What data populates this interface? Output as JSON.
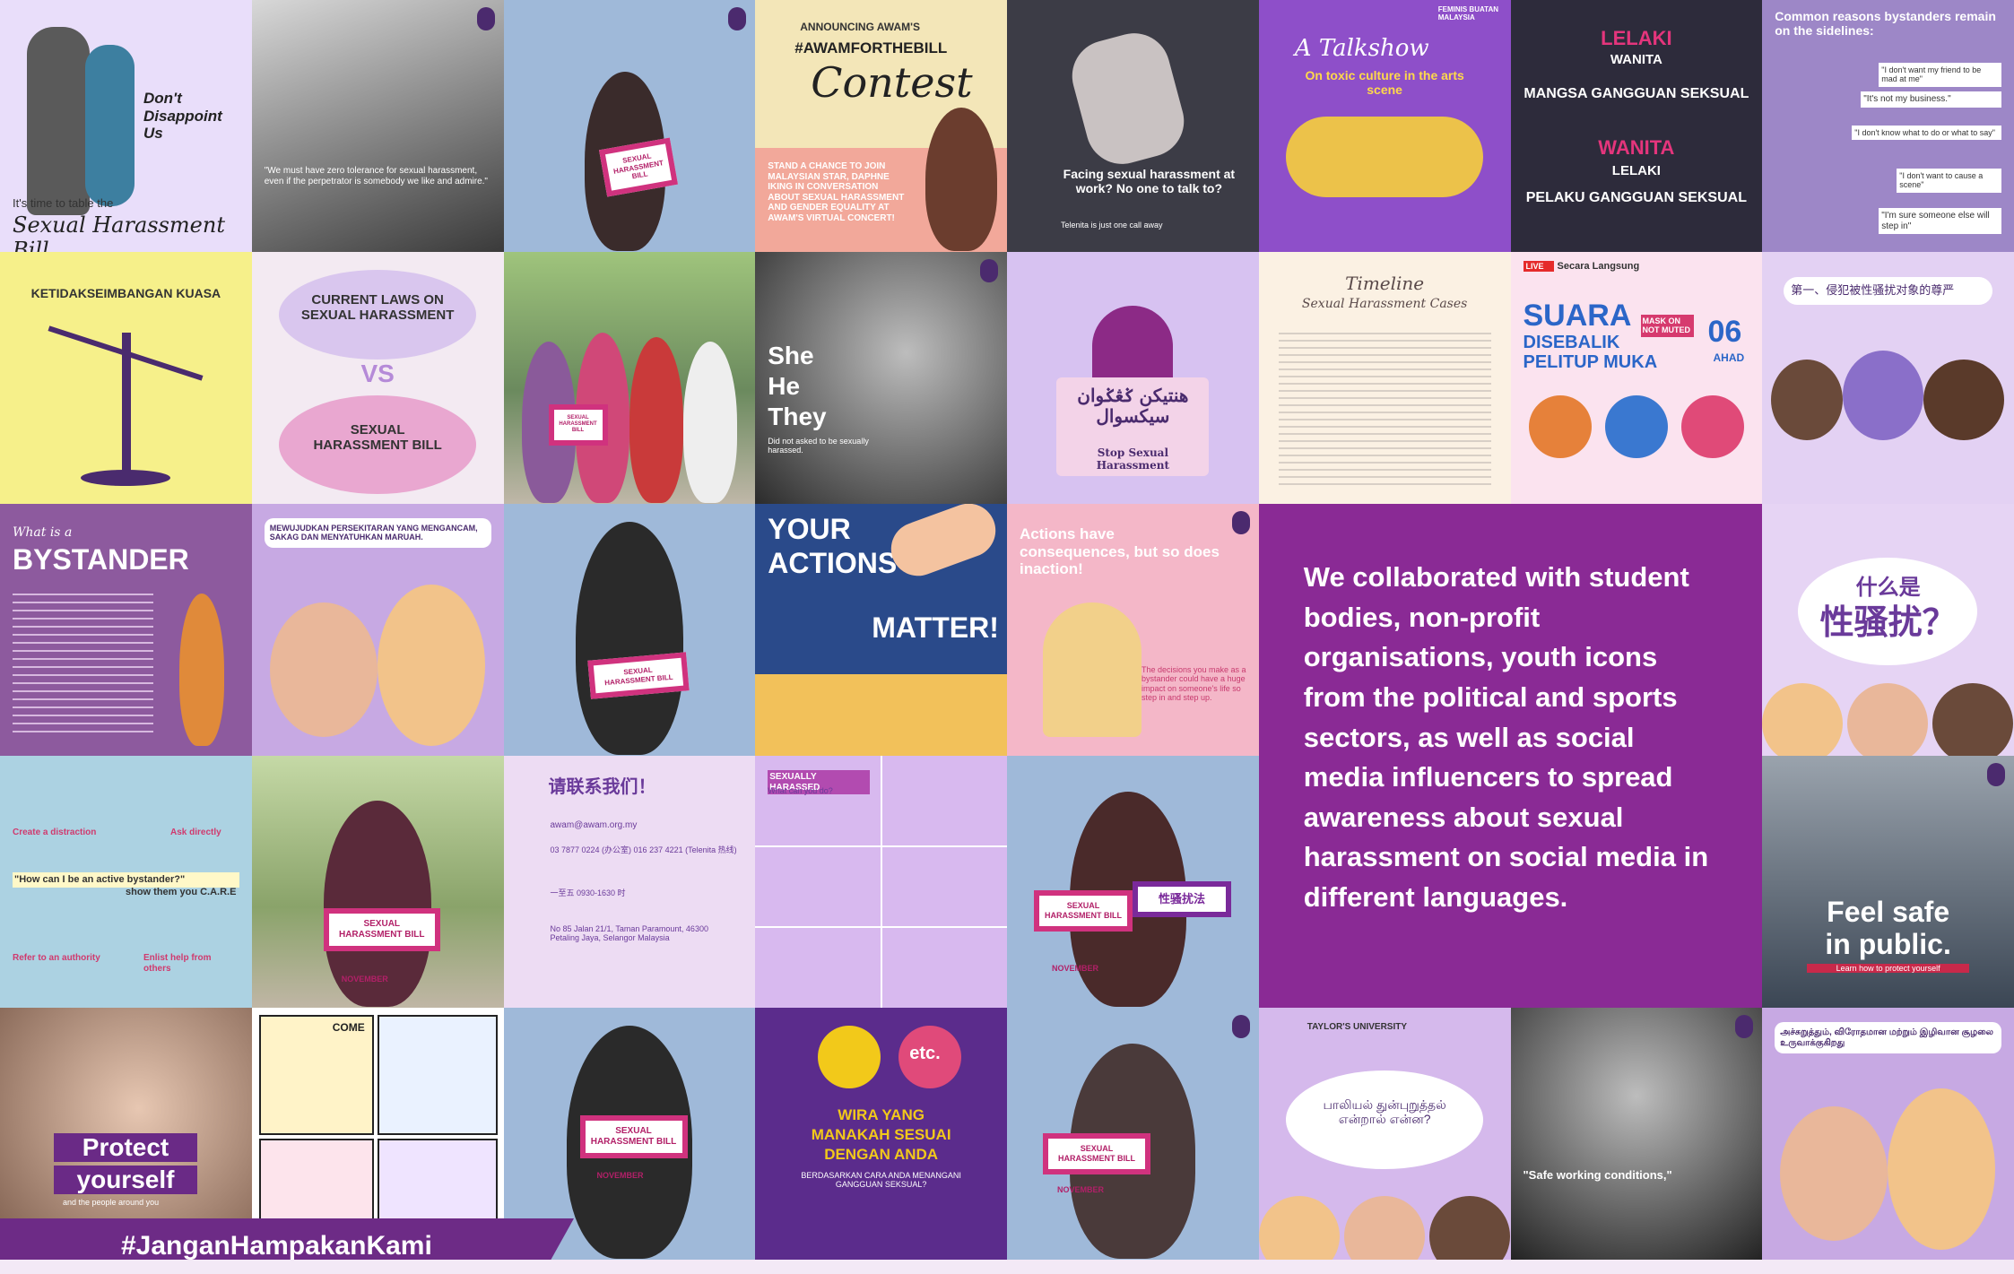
{
  "tiles": {
    "t1": {
      "title": "Don't Disappoint Us",
      "footer": "It's time to table the",
      "script": "Sexual Harassment Bill"
    },
    "t2": {
      "quote": "\"We must have zero tolerance for sexual harassment, even if the perpetrator is somebody we like and admire.\""
    },
    "t3": {
      "sign": "SEXUAL HARASSMENT BILL"
    },
    "t4": {
      "top": "ANNOUNCING AWAM'S",
      "tag": "#AWAMFORTHEBILL",
      "script": "Contest",
      "body": "STAND A CHANCE TO JOIN MALAYSIAN STAR, DAPHNE IKING IN CONVERSATION ABOUT SEXUAL HARASSMENT AND GENDER EQUALITY AT AWAM'S VIRTUAL CONCERT!"
    },
    "t5": {
      "text": "Facing sexual harassment at work? No one to talk to?",
      "small": "Telenita is just one call away"
    },
    "t6": {
      "script": "A Talkshow",
      "sub": "On toxic culture in the arts scene",
      "corner": "FEMINIS BUATAN MALAYSIA"
    },
    "t7": {
      "l1": "LELAKI",
      "l2": "WANITA",
      "l3": "MANGSA GANGGUAN SEKSUAL",
      "l4": "WANITA",
      "l5": "LELAKI",
      "l6": "PELAKU GANGGUAN SEKSUAL"
    },
    "t8": {
      "head": "Common reasons bystanders remain on the sidelines:",
      "q1": "\"I don't want my friend to be mad at me\"",
      "q2": "\"It's not my business.\"",
      "q3": "\"I don't know what to do or what to say\"",
      "q4": "\"I don't want to cause a scene\"",
      "q5": "\"I'm sure someone else will step in\""
    },
    "t9": {
      "head": "KETIDAKSEIMBANGAN KUASA"
    },
    "t10": {
      "top": "CURRENT LAWS ON SEXUAL HARASSMENT",
      "vs": "VS",
      "bottom": "SEXUAL HARASSMENT BILL"
    },
    "t11": {
      "sign": "SEXUAL HARASSMENT BILL"
    },
    "t12": {
      "l1": "She",
      "l2": "He",
      "l3": "They",
      "small": "Did not asked to be sexually harassed."
    },
    "t13": {
      "arabic": "هنتيكن ݢڠݢوان سيکسوال",
      "sign": "Stop Sexual Harassment"
    },
    "t14": {
      "script": "Timeline",
      "sub": "Sexual Harassment Cases"
    },
    "t15": {
      "live": "LIVE",
      "secara": "Secara Langsung",
      "title1": "SUARA",
      "title2": "DISEBALIK",
      "title3": "PELITUP MUKA",
      "mask": "MASK ON NOT MUTED",
      "num": "06",
      "day": "AHAD"
    },
    "t16": {
      "text": "第一、侵犯被性骚扰对象的尊严"
    },
    "t17": {
      "pre": "What is a",
      "title": "BYSTANDER"
    },
    "t18": {
      "head": "MEWUJUDKAN PERSEKITARAN YANG MENGANCAM, SAKAG DAN MENYATUHKAN MARUAH."
    },
    "t19": {
      "sign": "SEXUAL HARASSMENT BILL"
    },
    "t20": {
      "l1": "YOUR",
      "l2": "ACTIONS",
      "l3": "MATTER!"
    },
    "t21": {
      "head": "Actions have consequences, but so does inaction!",
      "foot": "The decisions you make as a bystander could have a huge impact on someone's life so step in and step up."
    },
    "t23": {
      "q": "什么是",
      "w": "性骚扰？"
    },
    "t24": {
      "a": "Create a distraction",
      "b": "Ask directly",
      "q": "\"How can I be an active bystander?\"",
      "s": "show them you C.A.R.E",
      "c": "Refer to an authority",
      "d": "Enlist help from others"
    },
    "t25": {
      "sign": "SEXUAL HARASSMENT BILL",
      "month": "NOVEMBER"
    },
    "t26": {
      "title": "请联系我们！",
      "email": "awam@awam.org.my",
      "phone": "03 7877 0224 (办公室) 016 237 4221 (Telenita 热线)",
      "hours": "一至五 0930-1630 时",
      "addr": "No 85 Jalan 21/1, Taman Paramount, 46300 Petaling Jaya, Selangor Malaysia"
    },
    "t27": {
      "head": "SEXUALLY HARASSED",
      "sub": "What can you do?"
    },
    "t28": {
      "sign": "SEXUAL HARASSMENT BILL",
      "sign2": "性骚扰法",
      "month": "NOVEMBER"
    },
    "t30": {
      "l1": "Feel safe",
      "l2": "in public.",
      "sub": "Learn how to protect yourself"
    },
    "t31": {
      "l1": "Protect",
      "l2": "yourself",
      "sub": "and the people around you"
    },
    "t32": {
      "come": "COME"
    },
    "t33": {
      "sign": "SEXUAL HARASSMENT BILL",
      "month": "NOVEMBER"
    },
    "t34": {
      "t1": "WIRA YANG",
      "t2": "MANAKAH SESUAI",
      "t3": "DENGAN ANDA",
      "t4": "BERDASARKAN CARA ANDA MENANGANI GANGGUAN SEKSUAL?",
      "etc": "etc."
    },
    "t35": {
      "sign": "SEXUAL HARASSMENT BILL",
      "month": "NOVEMBER"
    },
    "t36": {
      "uni": "TAYLOR'S UNIVERSITY",
      "text": "பாலியல் துன்புறுத்தல் என்றால் என்ன?"
    },
    "t37": {
      "text": "\"Safe working conditions,\""
    },
    "t38": {
      "text": "அச்சுறுத்தும், விரோதமான மற்றும் இழிவான சூழலை உருவாக்குகிறது"
    }
  },
  "feature_text": "We collaborated with student bodies, non-profit organisations, youth icons from the political and sports sectors, as well as social media influencers to spread awareness about sexual harassment on social media in different languages.",
  "hashtag": "#JanganHampakanKami"
}
